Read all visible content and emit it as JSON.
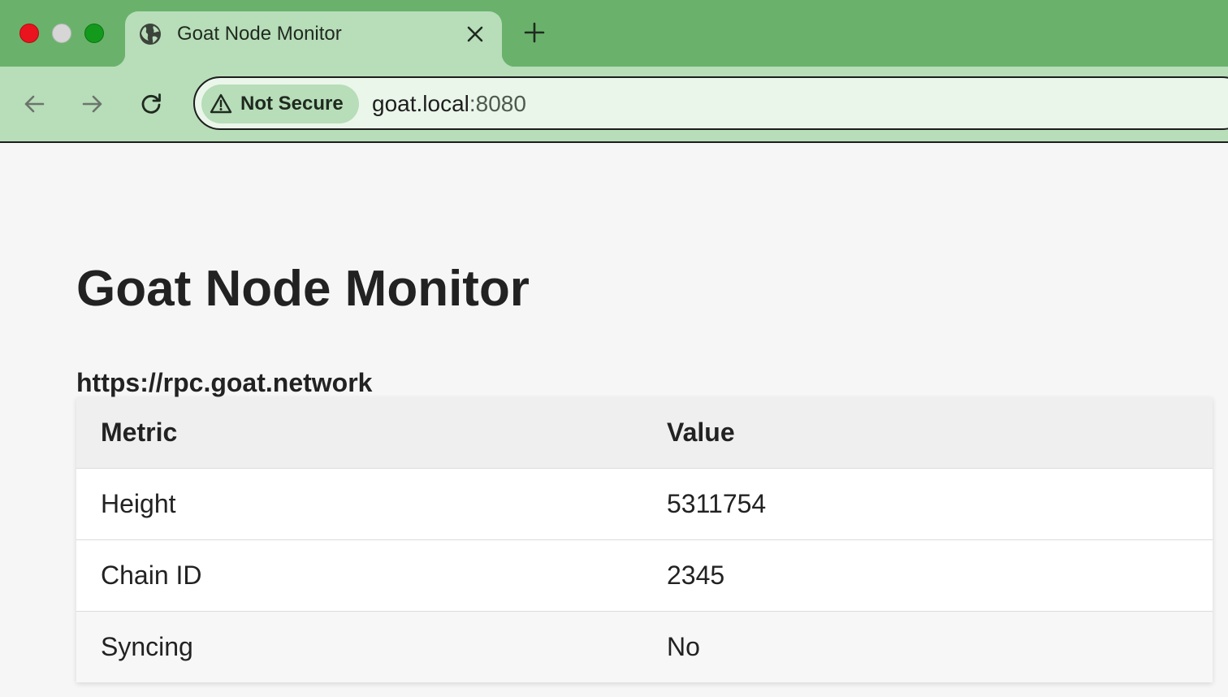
{
  "browser": {
    "tab": {
      "title": "Goat Node Monitor"
    },
    "address_bar": {
      "security_label": "Not Secure",
      "url_host": "goat.local",
      "url_port": ":8080"
    },
    "icons": {
      "favicon": "globe-icon",
      "tab_close": "close-icon",
      "new_tab": "plus-icon",
      "back": "arrow-left-icon",
      "forward": "arrow-right-icon",
      "reload": "reload-icon",
      "security": "warning-triangle-icon"
    },
    "colors": {
      "tabbar": "#6ab26b",
      "toolbar": "#b8ddb9",
      "omnibox": "#ebf6eb"
    }
  },
  "page": {
    "title": "Goat Node Monitor",
    "endpoint": "https://rpc.goat.network",
    "table": {
      "headers": [
        "Metric",
        "Value"
      ],
      "rows": [
        {
          "metric": "Height",
          "value": "5311754"
        },
        {
          "metric": "Chain ID",
          "value": "2345"
        },
        {
          "metric": "Syncing",
          "value": "No"
        }
      ]
    }
  }
}
